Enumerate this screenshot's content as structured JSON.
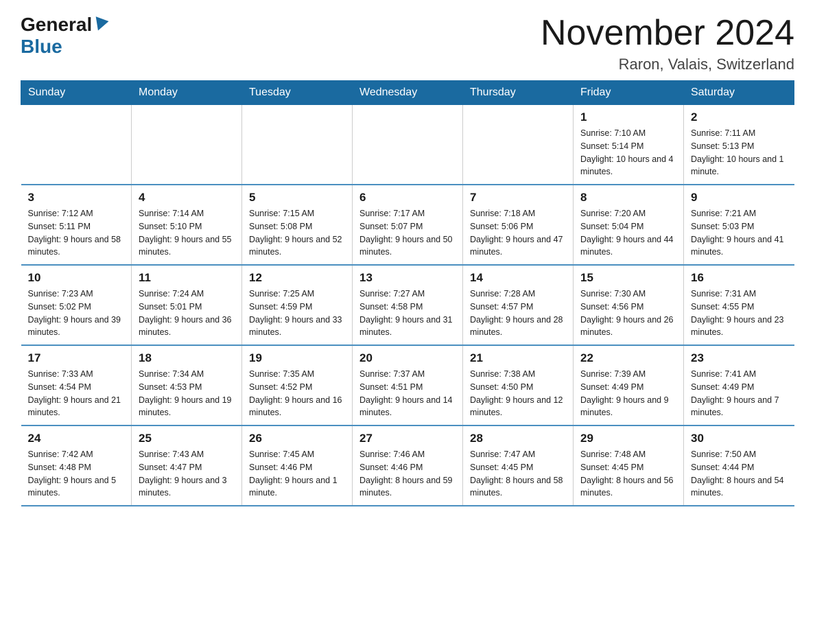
{
  "header": {
    "logo_general": "General",
    "logo_blue": "Blue",
    "title": "November 2024",
    "subtitle": "Raron, Valais, Switzerland"
  },
  "days_of_week": [
    "Sunday",
    "Monday",
    "Tuesday",
    "Wednesday",
    "Thursday",
    "Friday",
    "Saturday"
  ],
  "weeks": [
    [
      {
        "day": "",
        "info": ""
      },
      {
        "day": "",
        "info": ""
      },
      {
        "day": "",
        "info": ""
      },
      {
        "day": "",
        "info": ""
      },
      {
        "day": "",
        "info": ""
      },
      {
        "day": "1",
        "info": "Sunrise: 7:10 AM\nSunset: 5:14 PM\nDaylight: 10 hours and 4 minutes."
      },
      {
        "day": "2",
        "info": "Sunrise: 7:11 AM\nSunset: 5:13 PM\nDaylight: 10 hours and 1 minute."
      }
    ],
    [
      {
        "day": "3",
        "info": "Sunrise: 7:12 AM\nSunset: 5:11 PM\nDaylight: 9 hours and 58 minutes."
      },
      {
        "day": "4",
        "info": "Sunrise: 7:14 AM\nSunset: 5:10 PM\nDaylight: 9 hours and 55 minutes."
      },
      {
        "day": "5",
        "info": "Sunrise: 7:15 AM\nSunset: 5:08 PM\nDaylight: 9 hours and 52 minutes."
      },
      {
        "day": "6",
        "info": "Sunrise: 7:17 AM\nSunset: 5:07 PM\nDaylight: 9 hours and 50 minutes."
      },
      {
        "day": "7",
        "info": "Sunrise: 7:18 AM\nSunset: 5:06 PM\nDaylight: 9 hours and 47 minutes."
      },
      {
        "day": "8",
        "info": "Sunrise: 7:20 AM\nSunset: 5:04 PM\nDaylight: 9 hours and 44 minutes."
      },
      {
        "day": "9",
        "info": "Sunrise: 7:21 AM\nSunset: 5:03 PM\nDaylight: 9 hours and 41 minutes."
      }
    ],
    [
      {
        "day": "10",
        "info": "Sunrise: 7:23 AM\nSunset: 5:02 PM\nDaylight: 9 hours and 39 minutes."
      },
      {
        "day": "11",
        "info": "Sunrise: 7:24 AM\nSunset: 5:01 PM\nDaylight: 9 hours and 36 minutes."
      },
      {
        "day": "12",
        "info": "Sunrise: 7:25 AM\nSunset: 4:59 PM\nDaylight: 9 hours and 33 minutes."
      },
      {
        "day": "13",
        "info": "Sunrise: 7:27 AM\nSunset: 4:58 PM\nDaylight: 9 hours and 31 minutes."
      },
      {
        "day": "14",
        "info": "Sunrise: 7:28 AM\nSunset: 4:57 PM\nDaylight: 9 hours and 28 minutes."
      },
      {
        "day": "15",
        "info": "Sunrise: 7:30 AM\nSunset: 4:56 PM\nDaylight: 9 hours and 26 minutes."
      },
      {
        "day": "16",
        "info": "Sunrise: 7:31 AM\nSunset: 4:55 PM\nDaylight: 9 hours and 23 minutes."
      }
    ],
    [
      {
        "day": "17",
        "info": "Sunrise: 7:33 AM\nSunset: 4:54 PM\nDaylight: 9 hours and 21 minutes."
      },
      {
        "day": "18",
        "info": "Sunrise: 7:34 AM\nSunset: 4:53 PM\nDaylight: 9 hours and 19 minutes."
      },
      {
        "day": "19",
        "info": "Sunrise: 7:35 AM\nSunset: 4:52 PM\nDaylight: 9 hours and 16 minutes."
      },
      {
        "day": "20",
        "info": "Sunrise: 7:37 AM\nSunset: 4:51 PM\nDaylight: 9 hours and 14 minutes."
      },
      {
        "day": "21",
        "info": "Sunrise: 7:38 AM\nSunset: 4:50 PM\nDaylight: 9 hours and 12 minutes."
      },
      {
        "day": "22",
        "info": "Sunrise: 7:39 AM\nSunset: 4:49 PM\nDaylight: 9 hours and 9 minutes."
      },
      {
        "day": "23",
        "info": "Sunrise: 7:41 AM\nSunset: 4:49 PM\nDaylight: 9 hours and 7 minutes."
      }
    ],
    [
      {
        "day": "24",
        "info": "Sunrise: 7:42 AM\nSunset: 4:48 PM\nDaylight: 9 hours and 5 minutes."
      },
      {
        "day": "25",
        "info": "Sunrise: 7:43 AM\nSunset: 4:47 PM\nDaylight: 9 hours and 3 minutes."
      },
      {
        "day": "26",
        "info": "Sunrise: 7:45 AM\nSunset: 4:46 PM\nDaylight: 9 hours and 1 minute."
      },
      {
        "day": "27",
        "info": "Sunrise: 7:46 AM\nSunset: 4:46 PM\nDaylight: 8 hours and 59 minutes."
      },
      {
        "day": "28",
        "info": "Sunrise: 7:47 AM\nSunset: 4:45 PM\nDaylight: 8 hours and 58 minutes."
      },
      {
        "day": "29",
        "info": "Sunrise: 7:48 AM\nSunset: 4:45 PM\nDaylight: 8 hours and 56 minutes."
      },
      {
        "day": "30",
        "info": "Sunrise: 7:50 AM\nSunset: 4:44 PM\nDaylight: 8 hours and 54 minutes."
      }
    ]
  ]
}
